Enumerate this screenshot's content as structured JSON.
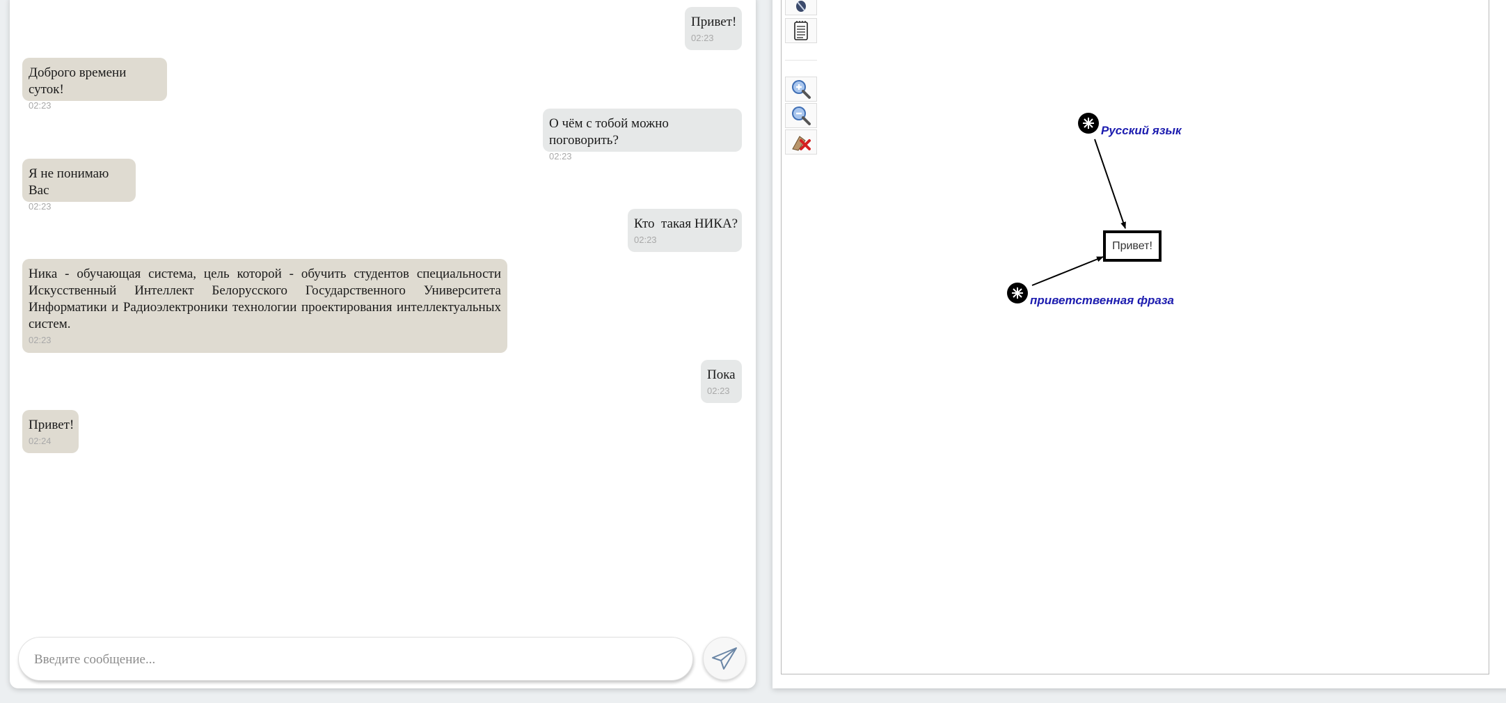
{
  "chat": {
    "messages": [
      {
        "sender": "user",
        "text": "Привет!",
        "time": "02:23"
      },
      {
        "sender": "bot",
        "text": "Доброго времени суток!",
        "time": "02:23"
      },
      {
        "sender": "user",
        "text": "О чём с тобой можно поговорить?",
        "time": "02:23"
      },
      {
        "sender": "bot",
        "text": "Я не понимаю Вас",
        "time": "02:23"
      },
      {
        "sender": "user",
        "text": "Кто  такая НИКА?",
        "time": "02:23"
      },
      {
        "sender": "bot",
        "text": "Ника - обучающая система, цель которой - обучить студентов специальности Искусственный Интеллект Белорусского Государственного Университета Информатики и Радиоэлектроники технологии проектирования интеллектуальных систем.",
        "time": "02:23"
      },
      {
        "sender": "user",
        "text": "Пока",
        "time": "02:23"
      },
      {
        "sender": "bot",
        "text": "Привет!",
        "time": "02:24"
      }
    ],
    "input": {
      "placeholder": "Введите сообщение...",
      "value": ""
    },
    "send_icon": "paper-plane-icon"
  },
  "toolbar": {
    "tools": [
      {
        "icon": "pen-icon"
      },
      {
        "icon": "notepad-icon"
      },
      {
        "icon": "zoom-in-icon"
      },
      {
        "icon": "zoom-out-icon"
      },
      {
        "icon": "clear-icon"
      }
    ]
  },
  "graph": {
    "nodes": [
      {
        "name": "Русский язык",
        "kind": "class-node"
      },
      {
        "name": "приветственная фраза",
        "kind": "class-node"
      },
      {
        "name": "Привет!",
        "kind": "text-link"
      }
    ],
    "label_color": "#1c1caf"
  },
  "colors": {
    "user_bubble": "#e6e8e8",
    "bot_bubble": "#dfdbd1",
    "timestamp": "#a9a9a9"
  }
}
